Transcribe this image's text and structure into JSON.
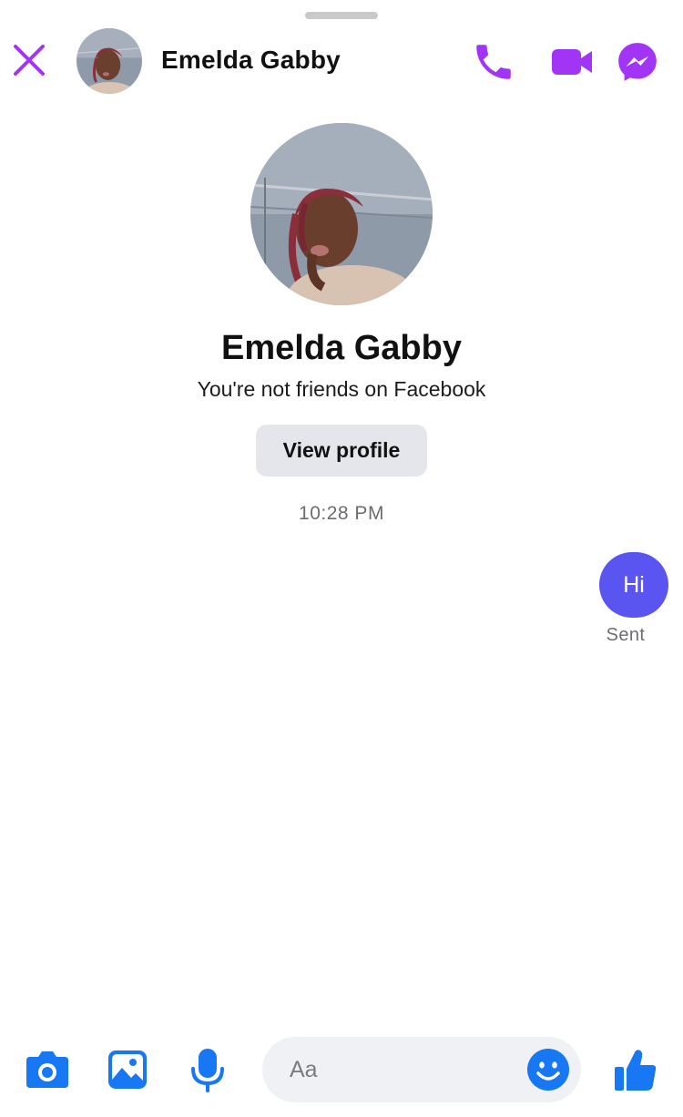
{
  "header": {
    "contact_name": "Emelda Gabby"
  },
  "profile": {
    "name": "Emelda Gabby",
    "relationship_note": "You're not friends on Facebook",
    "view_profile_label": "View profile"
  },
  "conversation": {
    "timestamp": "10:28 PM",
    "messages": [
      {
        "text": "Hi",
        "status": "Sent",
        "from": "me"
      }
    ]
  },
  "composer": {
    "placeholder": "Aa"
  },
  "icons": {
    "close": "close-icon",
    "call": "phone-icon",
    "video": "video-camera-icon",
    "messenger": "messenger-icon",
    "camera": "camera-icon",
    "gallery": "photo-gallery-icon",
    "mic": "microphone-icon",
    "emoji": "emoji-icon",
    "like": "thumbs-up-icon"
  },
  "colors": {
    "header_accent": "#a234f5",
    "composer_accent": "#1877f2",
    "bubble": "#5a55f0"
  }
}
